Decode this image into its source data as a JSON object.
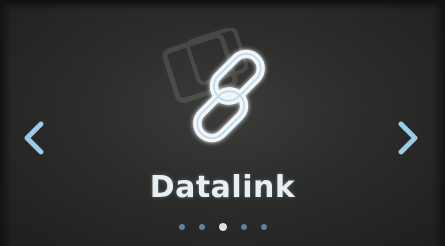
{
  "screen": {
    "title": "Datalink",
    "icon": "chain-link-icon",
    "ghost_icon": "device-icon"
  },
  "navigation": {
    "prev_icon": "chevron-left-icon",
    "next_icon": "chevron-right-icon",
    "arrow_color": "#9ccbe8"
  },
  "pager": {
    "total_pages": 5,
    "current_page": 3,
    "dot_color": "#5f8fb0",
    "active_dot_color": "#f2f6f8"
  },
  "colors": {
    "icon_stroke": "#f3f6f8",
    "icon_glow": "#8fc6e6",
    "text": "#e9eef1"
  }
}
